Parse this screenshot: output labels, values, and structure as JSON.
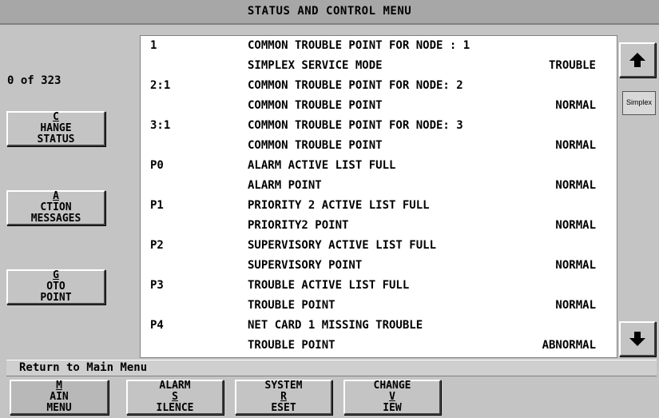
{
  "title": "STATUS AND CONTROL MENU",
  "counter": "0 of 323",
  "left_buttons": [
    {
      "line1_u": "C",
      "line1_rest": "HANGE",
      "line2": "STATUS"
    },
    {
      "line1_u": "A",
      "line1_rest": "CTION",
      "line2": "MESSAGES"
    },
    {
      "line1_u": "G",
      "line1_rest": "OTO",
      "line2": "POINT"
    }
  ],
  "rows": [
    {
      "id": "1",
      "desc": "COMMON TROUBLE POINT FOR NODE : 1",
      "status": ""
    },
    {
      "id": "",
      "desc": "SIMPLEX SERVICE MODE",
      "status": "TROUBLE"
    },
    {
      "id": "2:1",
      "desc": "COMMON TROUBLE POINT FOR NODE: 2",
      "status": ""
    },
    {
      "id": "",
      "desc": "COMMON TROUBLE POINT",
      "status": "NORMAL"
    },
    {
      "id": "3:1",
      "desc": "COMMON TROUBLE POINT FOR NODE: 3",
      "status": ""
    },
    {
      "id": "",
      "desc": "COMMON TROUBLE POINT",
      "status": "NORMAL"
    },
    {
      "id": "P0",
      "desc": "ALARM ACTIVE LIST FULL",
      "status": ""
    },
    {
      "id": "",
      "desc": "ALARM POINT",
      "status": "NORMAL"
    },
    {
      "id": "P1",
      "desc": "PRIORITY 2 ACTIVE LIST FULL",
      "status": ""
    },
    {
      "id": "",
      "desc": "PRIORITY2 POINT",
      "status": "NORMAL"
    },
    {
      "id": "P2",
      "desc": "SUPERVISORY ACTIVE LIST FULL",
      "status": ""
    },
    {
      "id": "",
      "desc": "SUPERVISORY POINT",
      "status": "NORMAL"
    },
    {
      "id": "P3",
      "desc": "TROUBLE ACTIVE LIST FULL",
      "status": ""
    },
    {
      "id": "",
      "desc": "TROUBLE POINT",
      "status": "NORMAL"
    },
    {
      "id": "P4",
      "desc": "NET CARD 1 MISSING TROUBLE",
      "status": ""
    },
    {
      "id": "",
      "desc": "TROUBLE POINT",
      "status": "ABNORMAL"
    }
  ],
  "scroll": {
    "up_icon": "up-arrow-icon",
    "down_icon": "down-arrow-icon",
    "logo": "Simplex"
  },
  "status_line": "Return to Main Menu",
  "bottom_buttons": [
    {
      "line1_u": "M",
      "line1_rest": "AIN",
      "line2_u": "",
      "line2": "MENU"
    },
    {
      "line1_u": "",
      "line1_rest": "ALARM",
      "line2_u": "S",
      "line2": "ILENCE"
    },
    {
      "line1_u": "",
      "line1_rest": "SYSTEM",
      "line2_u": "R",
      "line2": "ESET"
    },
    {
      "line1_u": "",
      "line1_rest": "CHANGE",
      "line2_u": "V",
      "line2": "IEW"
    }
  ]
}
